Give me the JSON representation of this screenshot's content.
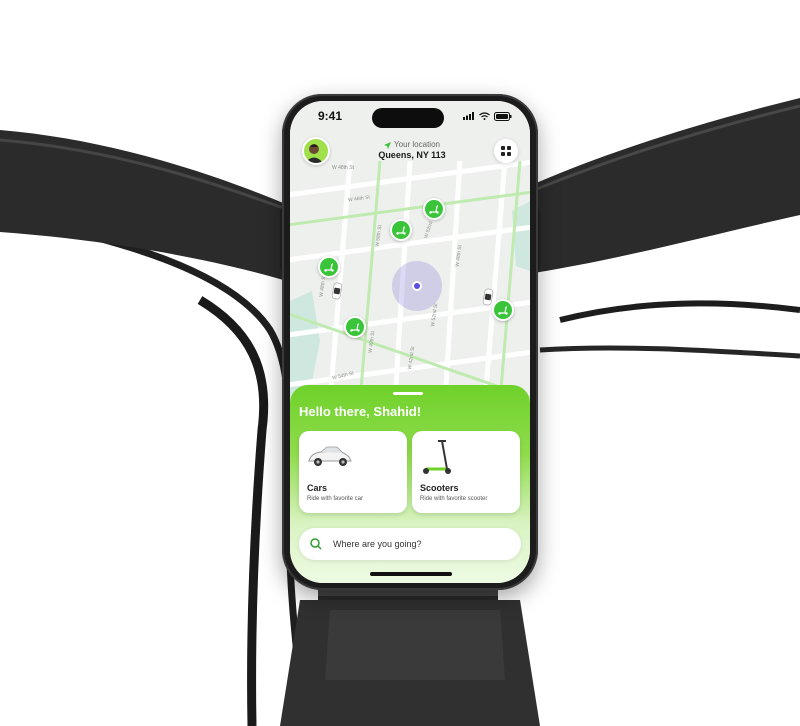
{
  "status_bar": {
    "time": "9:41"
  },
  "header": {
    "location_label": "Your location",
    "location_value": "Queens, NY 113"
  },
  "map": {
    "street_labels": [
      "W 48th St",
      "W 46th St",
      "W 52nd St",
      "W 58th St",
      "W 48th St",
      "W 48th St",
      "W 52nd St",
      "W 42nd St",
      "W 49th St",
      "W 54th St"
    ]
  },
  "sheet": {
    "greeting": "Hello there, Shahid!",
    "cards": [
      {
        "title": "Cars",
        "subtitle": "Ride with favorite car"
      },
      {
        "title": "Scooters",
        "subtitle": "Ride with favorite scooter"
      }
    ],
    "search_placeholder": "Where are you going?"
  },
  "colors": {
    "accent_green": "#6fd12a",
    "pin_green": "#3ac43a",
    "user_dot": "#5a4fe0"
  },
  "icons": [
    "location-arrow-icon",
    "grid-menu-icon",
    "scooter-icon",
    "car-icon",
    "search-icon",
    "signal-icon",
    "wifi-icon",
    "battery-icon"
  ]
}
